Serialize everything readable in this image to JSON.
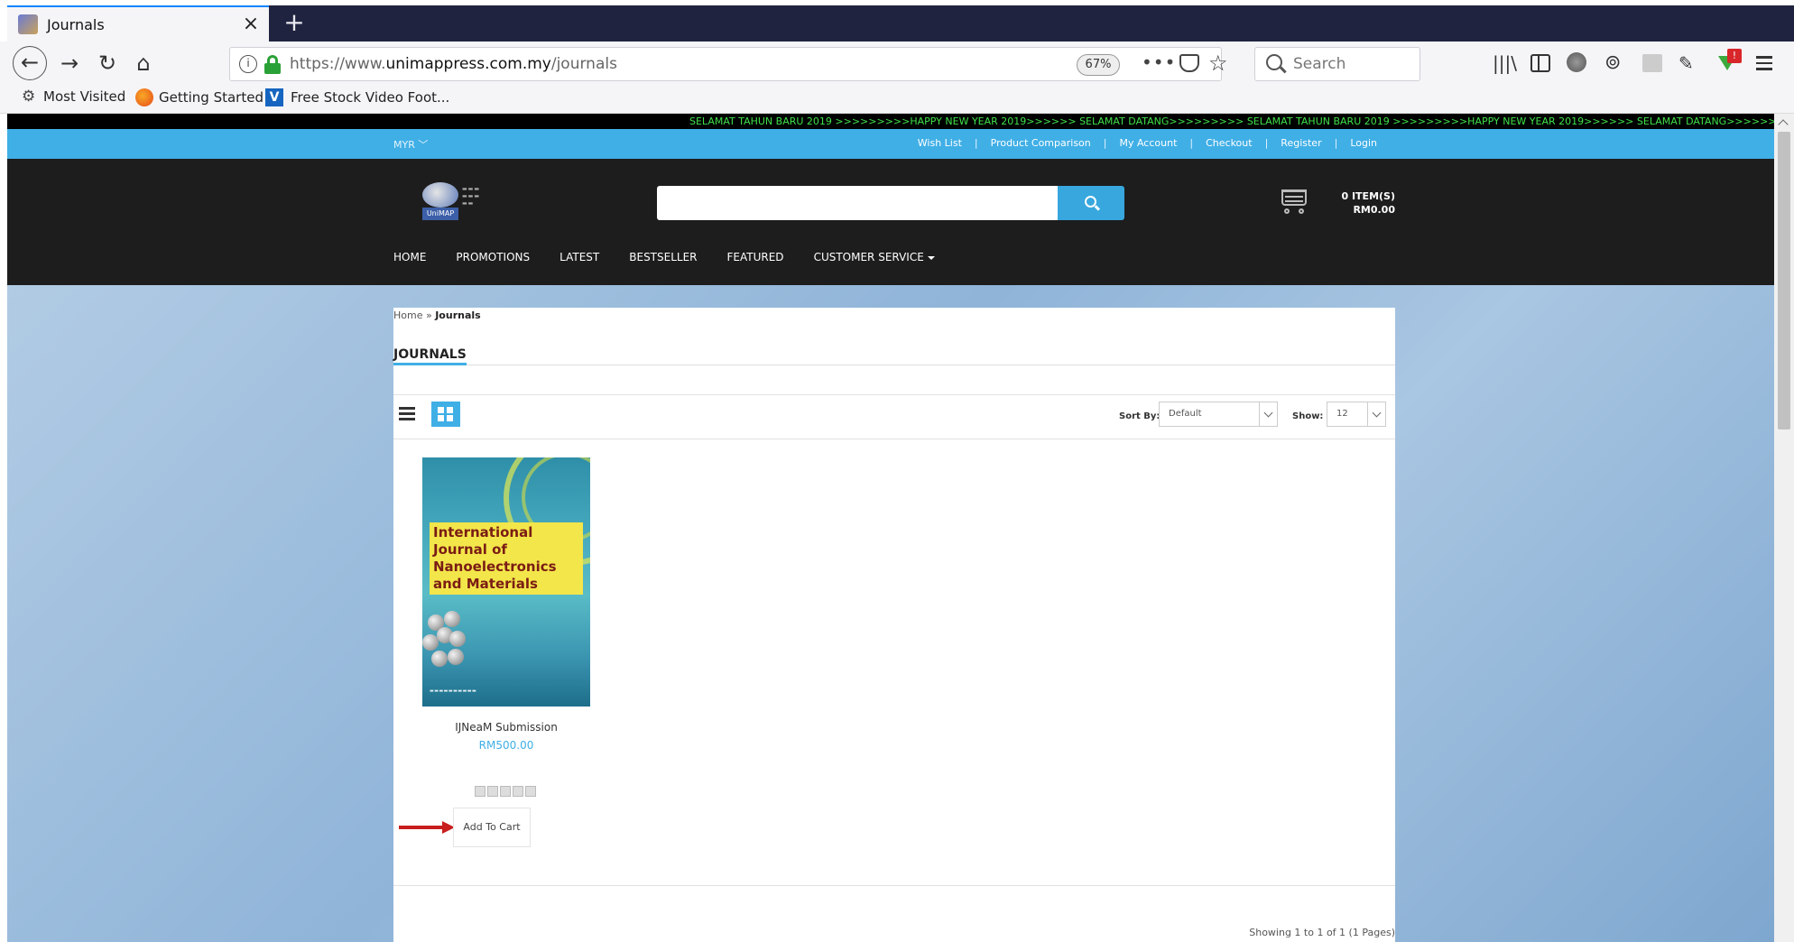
{
  "browser": {
    "tab_title": "Journals",
    "tab_close": "×",
    "new_tab": "+",
    "url_prefix": "https://www.",
    "url_domain": "unimappress.com.my",
    "url_path": "/journals",
    "zoom": "67%",
    "search_placeholder": "Search",
    "bookmarks": [
      "Most Visited",
      "Getting Started",
      "Free Stock Video Foot..."
    ],
    "extension_badge": "!"
  },
  "site": {
    "marquee": "SELAMAT TAHUN BARU 2019 >>>>>>>>>HAPPY NEW YEAR 2019>>>>>> SELAMAT DATANG>>>>>>>>> SELAMAT TAHUN BARU 2019 >>>>>>>>>HAPPY NEW YEAR 2019>>>>>> SELAMAT DATANG>>>>>>>>>",
    "currency": "MYR ﹀",
    "top_links": [
      "Wish List",
      "Product Comparison",
      "My Account",
      "Checkout",
      "Register",
      "Login"
    ],
    "top_link_separator": "|",
    "logo_badge": "UniMAP",
    "cart_items": "0 ITEM(S)",
    "cart_total": "RM0.00",
    "nav": [
      "HOME",
      "PROMOTIONS",
      "LATEST",
      "BESTSELLER",
      "FEATURED",
      "CUSTOMER SERVICE"
    ]
  },
  "page": {
    "breadcrumb_home": "Home",
    "breadcrumb_sep": " » ",
    "breadcrumb_current": "Journals",
    "heading": "JOURNALS",
    "sort_label": "Sort By:",
    "sort_value": "Default",
    "show_label": "Show:",
    "show_value": "12",
    "results": "Showing 1 to 1 of 1 (1 Pages)"
  },
  "product": {
    "cover_title": [
      "International",
      "Journal of",
      "Nanoelectronics",
      "and Materials"
    ],
    "name": "IJNeaM Submission",
    "price": "RM500.00",
    "rating": 0,
    "add_to_cart": "Add To Cart"
  },
  "colors": {
    "accent": "#40afe6",
    "header": "#1d1d1d",
    "marquee_text": "#40e04a",
    "arrow": "#c81e1e"
  }
}
